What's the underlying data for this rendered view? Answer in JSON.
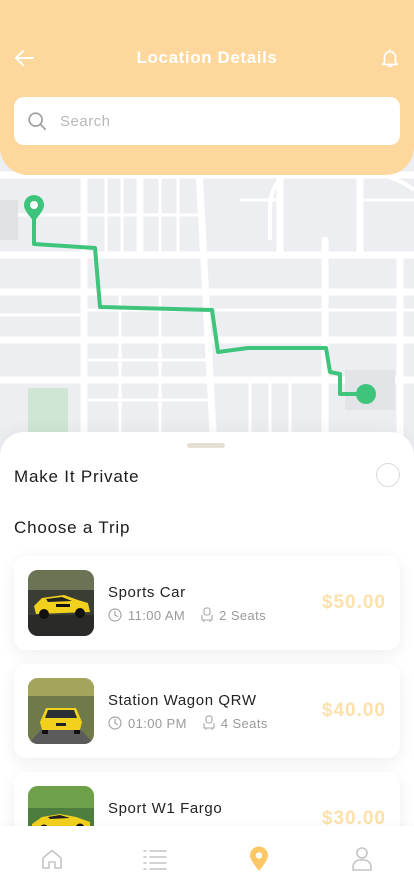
{
  "header": {
    "title": "Location Details",
    "search_placeholder": "Search",
    "background_color": "#fdd79b"
  },
  "map": {
    "route_color": "#3fc47c",
    "start_pin_icon": "map-pin-icon",
    "end_marker_icon": "circle-dot-icon"
  },
  "sheet": {
    "private_label": "Make It Private",
    "choose_label": "Choose a Trip"
  },
  "trips": [
    {
      "name": "Sports Car",
      "time": "11:00 AM",
      "seats": "2 Seats",
      "price": "$50.00"
    },
    {
      "name": "Station Wagon QRW",
      "time": "01:00 PM",
      "seats": "4 Seats",
      "price": "$40.00"
    },
    {
      "name": "Sport W1 Fargo",
      "time": "",
      "seats": "",
      "price": "$30.00"
    }
  ],
  "nav": {
    "items": [
      "home-icon",
      "list-icon",
      "location-icon",
      "profile-icon"
    ],
    "active": "location-icon",
    "active_color": "#fcc866",
    "inactive_color": "#c4c4c4"
  },
  "colors": {
    "price": "#fde0aa",
    "accent": "#fdd79b"
  }
}
